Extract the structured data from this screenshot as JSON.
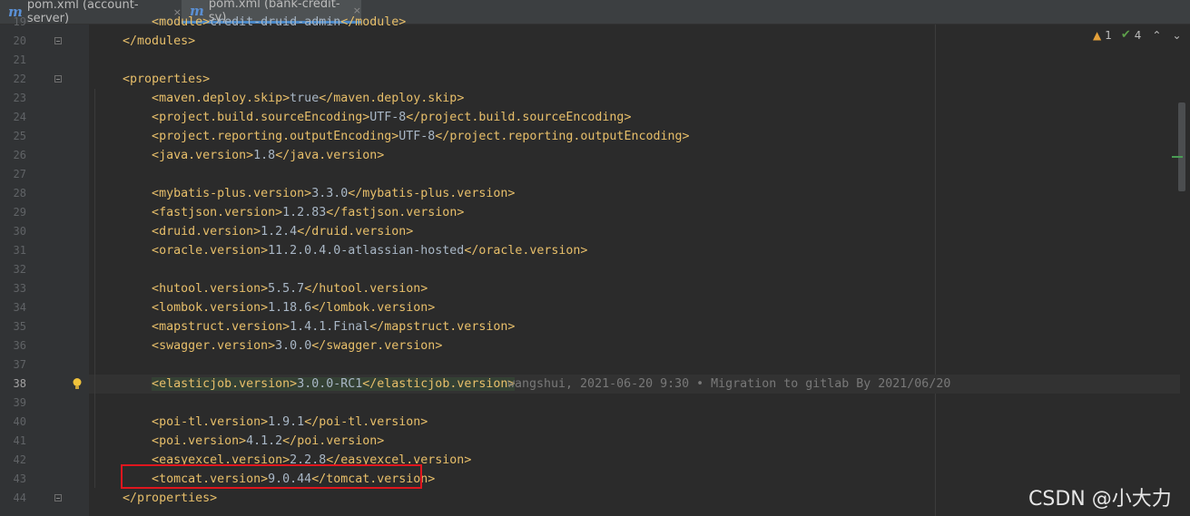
{
  "tabs": [
    {
      "label": "pom.xml (account-server)",
      "icon": "maven-m-icon",
      "close": "×"
    },
    {
      "label": "pom.xml (bank-credit-sy)",
      "icon": "maven-m-icon",
      "close": "×"
    }
  ],
  "icon_letter": "m",
  "inspections": {
    "warnings": "1",
    "ok": "4"
  },
  "current_line": "38",
  "blame": "wangshui, 2021-06-20 9:30 • Migration to gitlab By 2021/06/20",
  "lines": [
    {
      "num": "19",
      "indent": "        ",
      "open": "<",
      "tag": "module",
      "mid": ">",
      "text": "credit-druid-admin",
      "close_open": "</",
      "close_tag": "module",
      "end": ">"
    },
    {
      "num": "20",
      "indent": "    ",
      "open": "</",
      "tag": "modules",
      "end": ">"
    },
    {
      "num": "21"
    },
    {
      "num": "22",
      "indent": "    ",
      "open": "<",
      "tag": "properties",
      "end": ">"
    },
    {
      "num": "23",
      "indent": "        ",
      "open": "<",
      "tag": "maven.deploy.skip",
      "mid": ">",
      "text": "true",
      "close_open": "</",
      "close_tag": "maven.deploy.skip",
      "end": ">"
    },
    {
      "num": "24",
      "indent": "        ",
      "open": "<",
      "tag": "project.build.sourceEncoding",
      "mid": ">",
      "text": "UTF-8",
      "close_open": "</",
      "close_tag": "project.build.sourceEncoding",
      "end": ">"
    },
    {
      "num": "25",
      "indent": "        ",
      "open": "<",
      "tag": "project.reporting.outputEncoding",
      "mid": ">",
      "text": "UTF-8",
      "close_open": "</",
      "close_tag": "project.reporting.outputEncoding",
      "end": ">"
    },
    {
      "num": "26",
      "indent": "        ",
      "open": "<",
      "tag": "java.version",
      "mid": ">",
      "text": "1.8",
      "close_open": "</",
      "close_tag": "java.version",
      "end": ">"
    },
    {
      "num": "27"
    },
    {
      "num": "28",
      "indent": "        ",
      "open": "<",
      "tag": "mybatis-plus.version",
      "mid": ">",
      "text": "3.3.0",
      "close_open": "</",
      "close_tag": "mybatis-plus.version",
      "end": ">"
    },
    {
      "num": "29",
      "indent": "        ",
      "open": "<",
      "tag": "fastjson.version",
      "mid": ">",
      "text": "1.2.83",
      "close_open": "</",
      "close_tag": "fastjson.version",
      "end": ">"
    },
    {
      "num": "30",
      "indent": "        ",
      "open": "<",
      "tag": "druid.version",
      "mid": ">",
      "text": "1.2.4",
      "close_open": "</",
      "close_tag": "druid.version",
      "end": ">"
    },
    {
      "num": "31",
      "indent": "        ",
      "open": "<",
      "tag": "oracle.version",
      "mid": ">",
      "text": "11.2.0.4.0-atlassian-hosted",
      "close_open": "</",
      "close_tag": "oracle.version",
      "end": ">"
    },
    {
      "num": "32"
    },
    {
      "num": "33",
      "indent": "        ",
      "open": "<",
      "tag": "hutool.version",
      "mid": ">",
      "text": "5.5.7",
      "close_open": "</",
      "close_tag": "hutool.version",
      "end": ">"
    },
    {
      "num": "34",
      "indent": "        ",
      "open": "<",
      "tag": "lombok.version",
      "mid": ">",
      "text": "1.18.6",
      "close_open": "</",
      "close_tag": "lombok.version",
      "end": ">"
    },
    {
      "num": "35",
      "indent": "        ",
      "open": "<",
      "tag": "mapstruct.version",
      "mid": ">",
      "text": "1.4.1.Final",
      "close_open": "</",
      "close_tag": "mapstruct.version",
      "end": ">"
    },
    {
      "num": "36",
      "indent": "        ",
      "open": "<",
      "tag": "swagger.version",
      "mid": ">",
      "text": "3.0.0",
      "close_open": "</",
      "close_tag": "swagger.version",
      "end": ">"
    },
    {
      "num": "37"
    },
    {
      "num": "38",
      "indent": "        ",
      "open": "<",
      "tag": "elasticjob.version",
      "mid": ">",
      "text": "3.0.0-RC1",
      "close_open": "</",
      "close_tag": "elasticjob.version",
      "end": ">"
    },
    {
      "num": "39"
    },
    {
      "num": "40",
      "indent": "        ",
      "open": "<",
      "tag": "poi-tl.version",
      "mid": ">",
      "text": "1.9.1",
      "close_open": "</",
      "close_tag": "poi-tl.version",
      "end": ">"
    },
    {
      "num": "41",
      "indent": "        ",
      "open": "<",
      "tag": "poi.version",
      "mid": ">",
      "text": "4.1.2",
      "close_open": "</",
      "close_tag": "poi.version",
      "end": ">"
    },
    {
      "num": "42",
      "indent": "        ",
      "open": "<",
      "tag": "easyexcel.version",
      "mid": ">",
      "text": "2.2.8",
      "close_open": "</",
      "close_tag": "easyexcel.version",
      "end": ">"
    },
    {
      "num": "43",
      "indent": "        ",
      "open": "<",
      "tag": "tomcat.version",
      "mid": ">",
      "text": "9.0.44",
      "close_open": "</",
      "close_tag": "tomcat.version",
      "end": ">"
    },
    {
      "num": "44",
      "indent": "    ",
      "open": "</",
      "tag": "properties",
      "end": ">"
    }
  ],
  "watermark": "CSDN @小大力",
  "colors": {
    "tag": "#e8bf6a",
    "text": "#a9b7c6",
    "gutter": "#313335",
    "editor": "#2b2b2b",
    "highlight_box": "#e0161e"
  }
}
